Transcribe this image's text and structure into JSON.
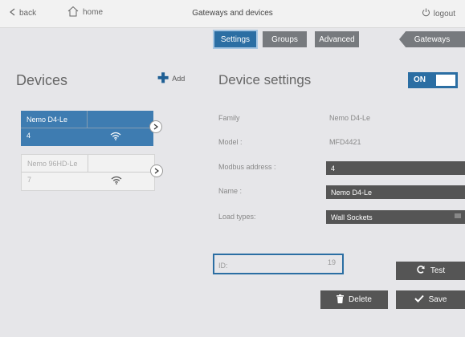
{
  "topbar": {
    "back_label": "back",
    "home_label": "home",
    "title": "Gateways and devices",
    "logout_label": "logout"
  },
  "tabs": [
    "Settings",
    "Groups",
    "Advanced",
    "Gateways"
  ],
  "devices": {
    "title": "Devices",
    "add_label": "Add",
    "items": [
      {
        "name": "Nemo D4-Le",
        "number": "4",
        "selected": true
      },
      {
        "name": "Nemo 96HD-Le",
        "number": "7",
        "selected": false
      }
    ]
  },
  "device_settings": {
    "title": "Device settings",
    "toggle_label": "ON",
    "fields": {
      "family_label": "Family",
      "family_value": "Nemo D4-Le",
      "model_label": "Model :",
      "model_value": "MFD4421",
      "modbus_label": "Modbus address :",
      "modbus_value": "4",
      "name_label": "Name :",
      "name_value": "Nemo D4-Le",
      "load_label": "Load types:",
      "load_value": "Wall Sockets"
    },
    "id_label": "ID:",
    "id_value": "19",
    "test_label": "Test",
    "delete_label": "Delete",
    "save_label": "Save"
  },
  "colors": {
    "accent": "#2b6ea3",
    "dark_button": "#555555",
    "selected_card": "#3e7cb1"
  },
  "icons": [
    "chevron-left-icon",
    "home-icon",
    "power-icon",
    "plus-icon",
    "wifi-icon",
    "chevron-right-icon",
    "refresh-icon",
    "trash-icon",
    "check-icon",
    "menu-icon"
  ]
}
